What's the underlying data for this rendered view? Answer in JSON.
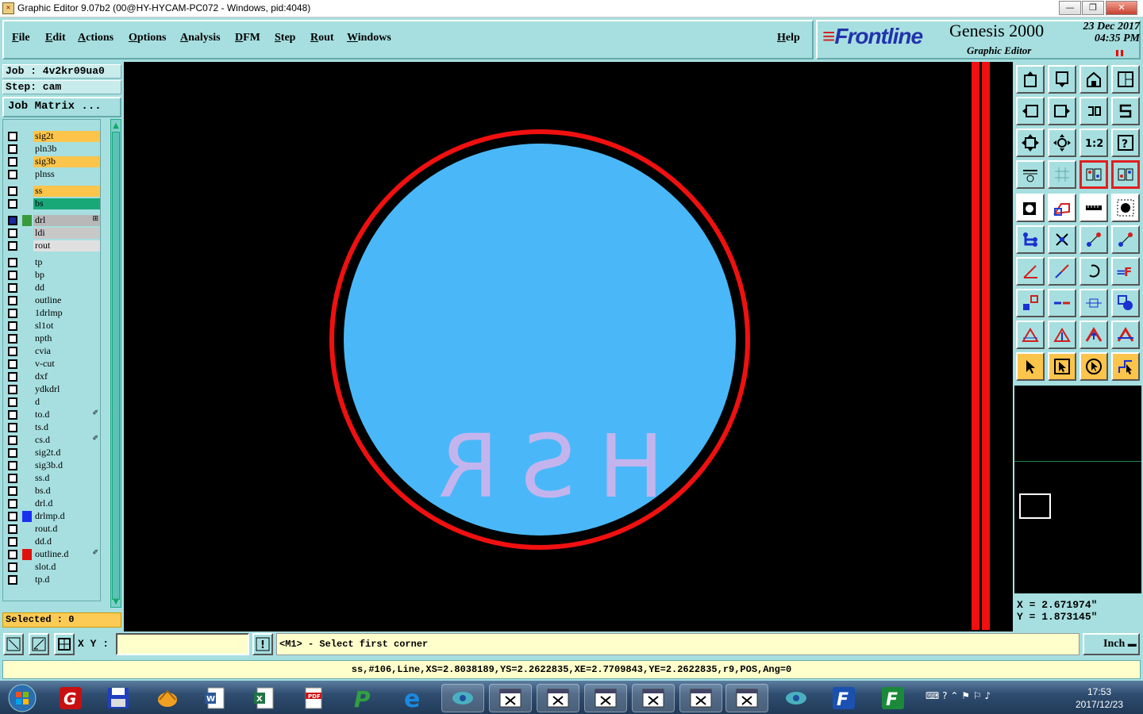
{
  "window": {
    "title": "Graphic Editor 9.07b2 (00@HY-HYCAM-PC072 - Windows, pid:4048)",
    "controls": [
      "—",
      "❐",
      "✕"
    ]
  },
  "menu": {
    "items": [
      "File",
      "Edit",
      "Actions",
      "Options",
      "Analysis",
      "DFM",
      "Step",
      "Rout",
      "Windows"
    ],
    "help": "Help"
  },
  "brand": {
    "logo": "Frontline",
    "product": "Genesis 2000",
    "subtitle": "Graphic Editor",
    "date": "23  Dec  2017",
    "time": "04:35  PM"
  },
  "job": {
    "job_label": "Job : 4v2kr09ua0",
    "step_label": "Step: cam",
    "matrix_button": "Job Matrix ..."
  },
  "layers": [
    {
      "name": "sig2t",
      "bg": "#fbc44b"
    },
    {
      "name": "pln3b",
      "bg": "#a7dfe0"
    },
    {
      "name": "sig3b",
      "bg": "#fbc44b"
    },
    {
      "name": "plnss",
      "bg": "#a7dfe0"
    },
    {
      "name": "ss",
      "bg": "#fbc44b"
    },
    {
      "name": "bs",
      "bg": "#18a878"
    },
    {
      "name": "drl",
      "bg": "#b8b8b8",
      "swatch": "#3a9a3a",
      "box": "#1a2a9a",
      "mark": "⊞"
    },
    {
      "name": "ldi",
      "bg": "#c8c8c8"
    },
    {
      "name": "rout",
      "bg": "#e0e0e0"
    },
    {
      "name": "tp",
      "bg": "#a7dfe0"
    },
    {
      "name": "bp",
      "bg": "#a7dfe0"
    },
    {
      "name": "dd",
      "bg": "#a7dfe0"
    },
    {
      "name": "outline",
      "bg": "#a7dfe0"
    },
    {
      "name": "1drlmp",
      "bg": "#a7dfe0"
    },
    {
      "name": "sl1ot",
      "bg": "#a7dfe0"
    },
    {
      "name": "npth",
      "bg": "#a7dfe0"
    },
    {
      "name": "cvia",
      "bg": "#a7dfe0"
    },
    {
      "name": "v-cut",
      "bg": "#a7dfe0"
    },
    {
      "name": "dxf",
      "bg": "#a7dfe0"
    },
    {
      "name": "ydkdrl",
      "bg": "#a7dfe0"
    },
    {
      "name": "d",
      "bg": "#a7dfe0"
    },
    {
      "name": "to.d",
      "bg": "#a7dfe0",
      "mark": "✐"
    },
    {
      "name": "ts.d",
      "bg": "#a7dfe0"
    },
    {
      "name": "cs.d",
      "bg": "#a7dfe0",
      "mark": "✐"
    },
    {
      "name": "sig2t.d",
      "bg": "#a7dfe0"
    },
    {
      "name": "sig3b.d",
      "bg": "#a7dfe0"
    },
    {
      "name": "ss.d",
      "bg": "#a7dfe0"
    },
    {
      "name": "bs.d",
      "bg": "#a7dfe0"
    },
    {
      "name": "drl.d",
      "bg": "#a7dfe0"
    },
    {
      "name": "drlmp.d",
      "bg": "#a7dfe0",
      "swatch": "#1a30f0"
    },
    {
      "name": "rout.d",
      "bg": "#a7dfe0"
    },
    {
      "name": "dd.d",
      "bg": "#a7dfe0"
    },
    {
      "name": "outline.d",
      "bg": "#a7dfe0",
      "swatch": "#e01010",
      "mark": "✐"
    },
    {
      "name": "slot.d",
      "bg": "#a7dfe0"
    },
    {
      "name": "tp.d",
      "bg": "#a7dfe0"
    }
  ],
  "selected": "Selected : 0",
  "canvas": {
    "text": "HSR",
    "outer_ring_color": "#f01010",
    "fill_color": "#4ab8f8",
    "text_color": "#c4b4ee"
  },
  "coords": {
    "x": "X = 2.671974\"",
    "y": "Y = 1.873145\""
  },
  "input": {
    "xy_label": "X Y :",
    "xy_value": "",
    "message": "<M1> - Select first corner",
    "unit": "Inch"
  },
  "status": "ss,#106,Line,XS=2.8038189,YS=2.2622835,XE=2.7709843,YE=2.2622835,r9,POS,Ang=0",
  "taskbar": {
    "clock_time": "17:53",
    "clock_date": "2017/12/23"
  }
}
